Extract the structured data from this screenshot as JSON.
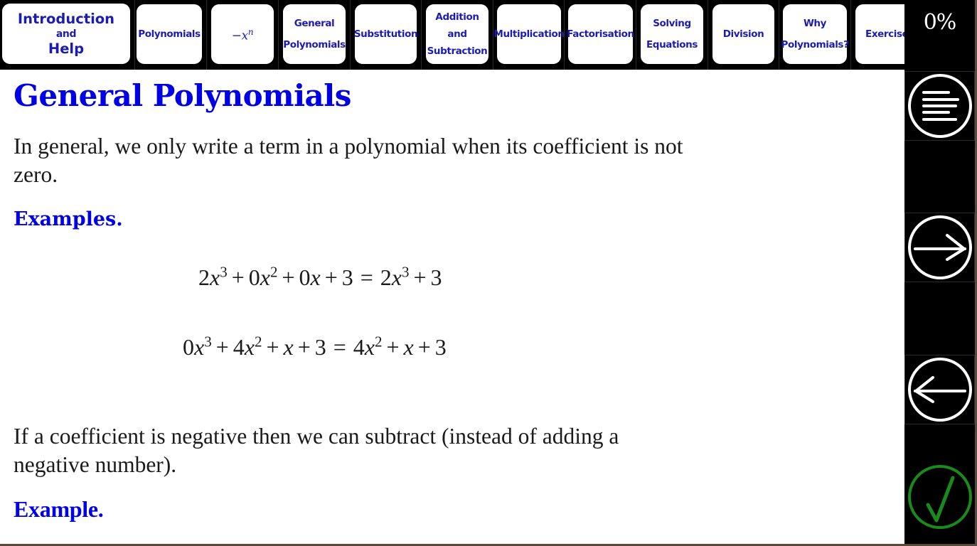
{
  "nav": {
    "tabs": [
      {
        "id": "intro",
        "lines": [
          "Introduction",
          "and",
          "Help"
        ]
      },
      {
        "id": "polynomials",
        "lines": [
          "Polynomials"
        ]
      },
      {
        "id": "neg-x-n",
        "math_base": "−x",
        "math_sup": "n"
      },
      {
        "id": "general-polynomials",
        "lines": [
          "General",
          "Polynomials"
        ]
      },
      {
        "id": "substitution",
        "lines": [
          "Substitution"
        ]
      },
      {
        "id": "addition-subtraction",
        "lines": [
          "Addition",
          "and",
          "Subtraction"
        ]
      },
      {
        "id": "multiplication",
        "lines": [
          "Multiplication"
        ]
      },
      {
        "id": "factorisation",
        "lines": [
          "Factorisation"
        ]
      },
      {
        "id": "solving-equations",
        "lines": [
          "Solving",
          "Equations"
        ]
      },
      {
        "id": "division",
        "lines": [
          "Division"
        ]
      },
      {
        "id": "why-polynomials",
        "lines": [
          "Why",
          "Polynomials?"
        ]
      },
      {
        "id": "exercises",
        "lines": [
          "Exercises"
        ]
      }
    ]
  },
  "sidebar": {
    "progress": "0%",
    "buttons": [
      {
        "icon": "menu-icon",
        "label": "Contents"
      },
      {
        "icon": "arrow-right-icon",
        "label": "Next"
      },
      {
        "icon": "arrow-left-icon",
        "label": "Back"
      },
      {
        "icon": "checkmark-icon",
        "label": "Check",
        "color": "#1a8a1a"
      }
    ]
  },
  "content": {
    "title": "General Polynomials",
    "para1": "In general, we only write a term in a polynomial when its coefficient is not zero.",
    "examples_heading": "Examples.",
    "equations": [
      {
        "lhs": [
          [
            "2",
            "x",
            "3"
          ],
          [
            "+"
          ],
          [
            "0",
            "x",
            "2"
          ],
          [
            "+"
          ],
          [
            "0",
            "x",
            ""
          ],
          [
            "+"
          ],
          [
            "3",
            "",
            ""
          ]
        ],
        "rhs": [
          [
            "2",
            "x",
            "3"
          ],
          [
            "+"
          ],
          [
            "3",
            "",
            ""
          ]
        ]
      },
      {
        "lhs": [
          [
            "0",
            "x",
            "3"
          ],
          [
            "+"
          ],
          [
            "4",
            "x",
            "2"
          ],
          [
            "+"
          ],
          [
            "",
            "x",
            ""
          ],
          [
            "+"
          ],
          [
            "3",
            "",
            ""
          ]
        ],
        "rhs": [
          [
            "4",
            "x",
            "2"
          ],
          [
            "+"
          ],
          [
            "",
            "x",
            ""
          ],
          [
            "+"
          ],
          [
            "3",
            "",
            ""
          ]
        ]
      }
    ],
    "para2": "If a coefficient is negative then we can subtract (instead of adding a negative number).",
    "example_heading": "Example."
  },
  "colors": {
    "accent": "#0000e6",
    "nav_text": "#1c1cb4",
    "check": "#1a8a1a"
  }
}
